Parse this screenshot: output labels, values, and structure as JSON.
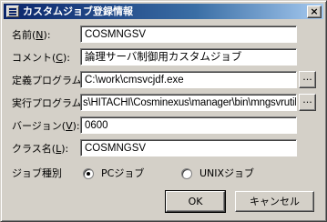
{
  "window": {
    "title": "カスタムジョブ登録情報",
    "close_label": "×"
  },
  "form": {
    "name": {
      "label": "名前(",
      "mnemonic": "N",
      "suffix": "):",
      "value": "COSMNGSV"
    },
    "comment": {
      "label": "コメント(",
      "mnemonic": "C",
      "suffix": "):",
      "value": "論理サーバ制御用カスタムジョブ"
    },
    "definition_program": {
      "label": "定義プログラム(",
      "mnemonic": "D",
      "suffix": "):",
      "value": "C:\\work\\cmsvcjdf.exe",
      "browse_label": "..."
    },
    "execution_program": {
      "label": "実行プログラム(",
      "mnemonic": "X",
      "suffix": "):",
      "value": "s\\HITACHI\\Cosminexus\\manager\\bin\\mngsvrutil.exe",
      "browse_label": "..."
    },
    "version": {
      "label": "バージョン(",
      "mnemonic": "V",
      "suffix": "):",
      "value": "0600"
    },
    "class_name": {
      "label": "クラス名(",
      "mnemonic": "L",
      "suffix": "):",
      "value": "COSMNGSV"
    },
    "job_type": {
      "label": "ジョブ種別",
      "options": [
        {
          "label": "PCジョブ",
          "checked": true
        },
        {
          "label": "UNIXジョブ",
          "checked": false
        }
      ]
    }
  },
  "buttons": {
    "ok": "OK",
    "cancel": "キャンセル"
  }
}
